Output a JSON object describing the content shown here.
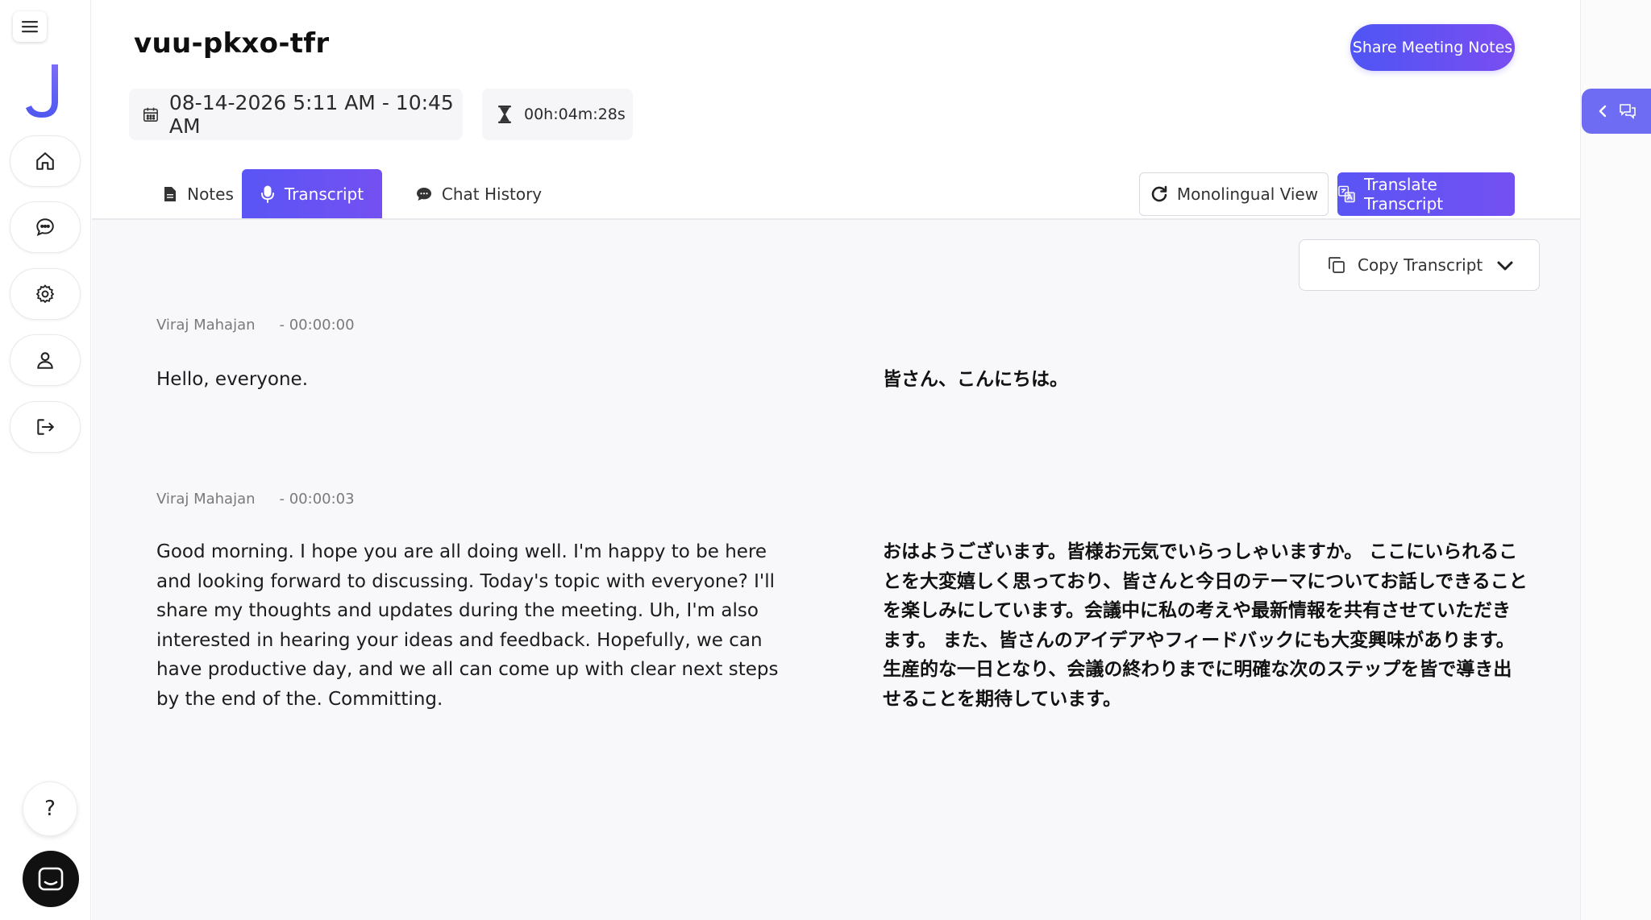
{
  "meeting": {
    "title": "vuu-pkxo-tfr",
    "datetime": "08-14-2026 5:11 AM - 10:45 AM",
    "duration": "00h:04m:28s"
  },
  "header": {
    "share_label": "Share Meeting Notes"
  },
  "tabs": [
    {
      "label": "Notes",
      "icon": "document-icon",
      "active": false
    },
    {
      "label": "Transcript",
      "icon": "microphone-icon",
      "active": true
    },
    {
      "label": "Chat History",
      "icon": "chat-bubble-icon",
      "active": false
    }
  ],
  "toolbar": {
    "monolingual_label": "Monolingual View",
    "translate_label": "Translate Transcript",
    "copy_label": "Copy Transcript"
  },
  "transcript": [
    {
      "speaker": "Viraj Mahajan",
      "timestamp": "- 00:00:00",
      "text": "Hello, everyone.",
      "translation": "皆さん、こんにちは。"
    },
    {
      "speaker": "Viraj Mahajan",
      "timestamp": "- 00:00:03",
      "text": "Good morning. I hope you are all doing well. I'm happy to be here and looking forward to discussing. Today's topic with everyone? I'll share my thoughts and updates during the meeting. Uh, I'm also interested in hearing your ideas and feedback. Hopefully, we can have productive day, and we all can come up with clear next steps by the end of the. Committing.",
      "translation": "おはようございます。皆様お元気でいらっしゃいますか。 ここにいられることを大変嬉しく思っており、皆さんと今日のテーマについてお話しできることを楽しみにしています。会議中に私の考えや最新情報を共有させていただきます。 また、皆さんのアイデアやフィードバックにも大変興味があります。生産的な一日となり、会議の終わりまでに明確な次のステップを皆で導き出せることを期待しています。"
    }
  ],
  "sidebar": {
    "logo_letter": "J",
    "help_label": "?",
    "items": [
      {
        "icon": "home-icon"
      },
      {
        "icon": "chat-icon"
      },
      {
        "icon": "gear-icon"
      },
      {
        "icon": "user-icon"
      },
      {
        "icon": "logout-icon"
      }
    ]
  },
  "colors": {
    "accent": "#5a55f5",
    "accent_end": "#7450f2",
    "panel_bg": "#f8f8fa"
  }
}
